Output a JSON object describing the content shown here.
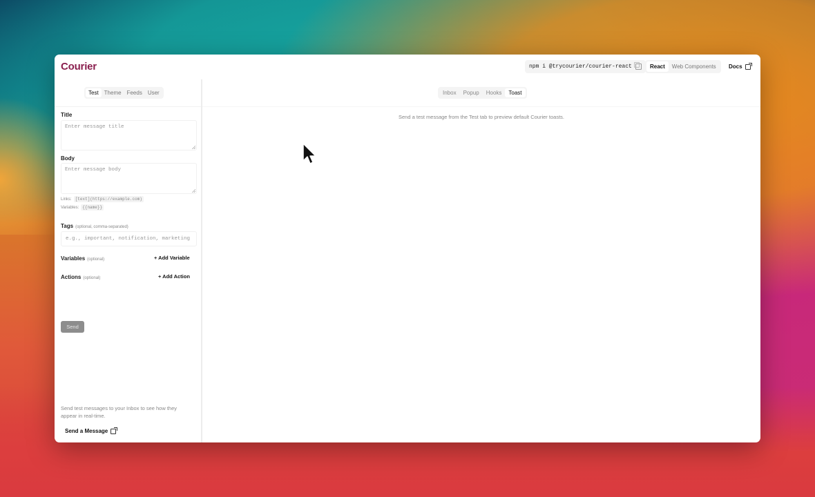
{
  "app": {
    "logo": "Courier",
    "install_cmd": "npm i @trycourier/courier-react",
    "framework_tabs": [
      "React",
      "Web Components"
    ],
    "docs_label": "Docs"
  },
  "sidebar": {
    "tabs": [
      "Test",
      "Theme",
      "Feeds",
      "User"
    ],
    "title_label": "Title",
    "title_placeholder": "Enter message title",
    "body_label": "Body",
    "body_placeholder": "Enter message body",
    "links_hint_label": "Links:",
    "links_hint_code": "[text](https://example.com)",
    "variables_hint_label": "Variables:",
    "variables_hint_code": "{{name}}",
    "tags_label": "Tags",
    "tags_note": "(optional, comma-separated)",
    "tags_placeholder": "e.g., important, notification, marketing",
    "variables_label": "Variables",
    "variables_note": "(optional)",
    "add_variable": "+ Add Variable",
    "actions_label": "Actions",
    "actions_note": "(optional)",
    "add_action": "+ Add Action",
    "send_button": "Send",
    "footer_text": "Send test messages to your Inbox to see how they appear in real-time.",
    "send_message_link": "Send a Message"
  },
  "main": {
    "tabs": [
      "Inbox",
      "Popup",
      "Hooks",
      "Toast"
    ],
    "active_tab": "Toast",
    "message": "Send a test message from the Test tab to preview default Courier toasts."
  }
}
